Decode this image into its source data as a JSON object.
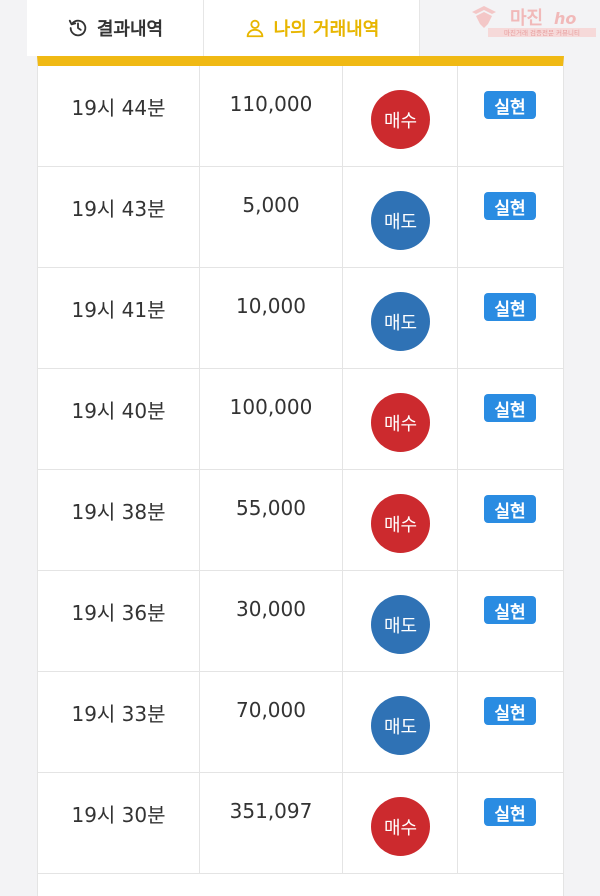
{
  "tabs": [
    {
      "label": "결과내역",
      "icon": "history-icon",
      "active": false
    },
    {
      "label": "나의 거래내역",
      "icon": "user-icon",
      "active": true
    }
  ],
  "brand": {
    "name": "마진",
    "tagline": "마진거래 검증전문 커뮤니티"
  },
  "colors": {
    "accent": "#f0b914",
    "buy": "#cc2a2e",
    "sell": "#2f72b5",
    "status": "#2a8ce2"
  },
  "trades": [
    {
      "time": "19시 44분",
      "amount": "110,000",
      "type": "매수",
      "kind": "buy",
      "status": "실현"
    },
    {
      "time": "19시 43분",
      "amount": "5,000",
      "type": "매도",
      "kind": "sell",
      "status": "실현"
    },
    {
      "time": "19시 41분",
      "amount": "10,000",
      "type": "매도",
      "kind": "sell",
      "status": "실현"
    },
    {
      "time": "19시 40분",
      "amount": "100,000",
      "type": "매수",
      "kind": "buy",
      "status": "실현"
    },
    {
      "time": "19시 38분",
      "amount": "55,000",
      "type": "매수",
      "kind": "buy",
      "status": "실현"
    },
    {
      "time": "19시 36분",
      "amount": "30,000",
      "type": "매도",
      "kind": "sell",
      "status": "실현"
    },
    {
      "time": "19시 33분",
      "amount": "70,000",
      "type": "매도",
      "kind": "sell",
      "status": "실현"
    },
    {
      "time": "19시 30분",
      "amount": "351,097",
      "type": "매수",
      "kind": "buy",
      "status": "실현"
    }
  ]
}
